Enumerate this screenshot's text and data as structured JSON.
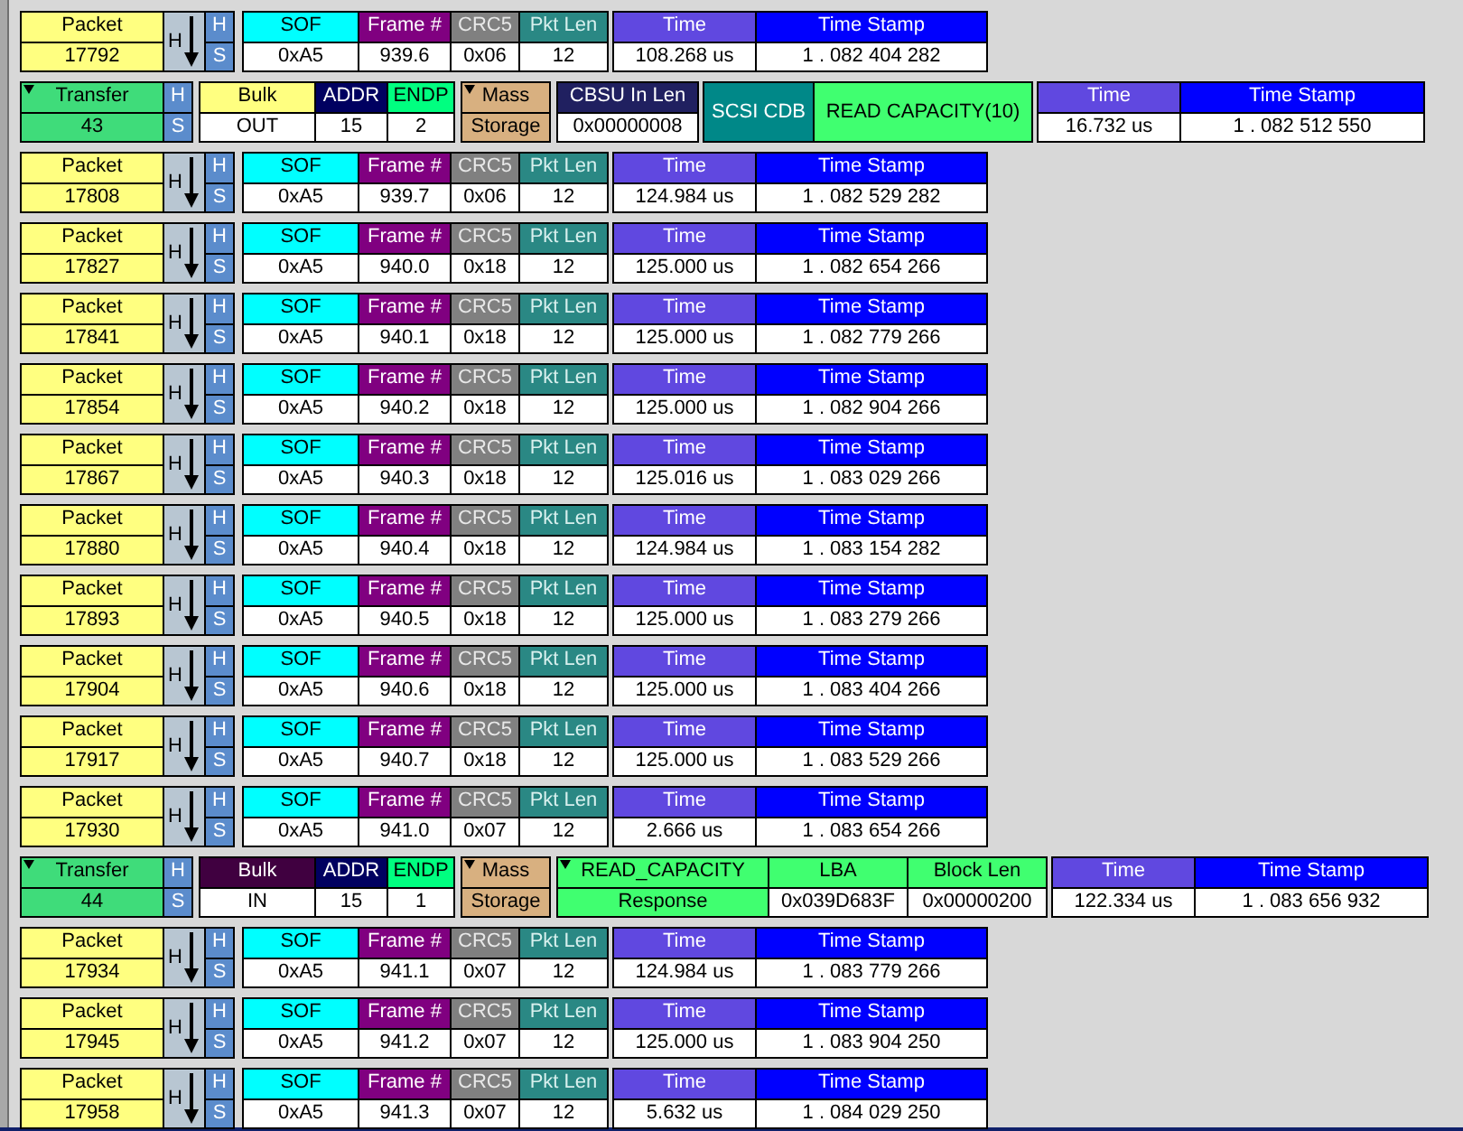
{
  "rows": [
    {
      "kind": "packet",
      "title": "Packet",
      "number": "17792",
      "arrow_label": "H",
      "speed": [
        "H",
        "S"
      ],
      "fields": [
        {
          "label": "SOF",
          "value": "0xA5"
        },
        {
          "label": "Frame #",
          "value": "939.6"
        },
        {
          "label": "CRC5",
          "value": "0x06"
        },
        {
          "label": "Pkt Len",
          "value": "12"
        }
      ],
      "time": {
        "label": "Time",
        "value": "108.268 us"
      },
      "timestamp": {
        "label": "Time Stamp",
        "value": "1 . 082 404 282"
      }
    },
    {
      "kind": "transfer",
      "title": "Transfer",
      "number": "43",
      "speed": [
        "H",
        "S"
      ],
      "incoming": false,
      "transfer": {
        "label": "Bulk",
        "value": "OUT"
      },
      "addr": {
        "label": "ADDR",
        "value": "15"
      },
      "endp": {
        "label": "ENDP",
        "value": "2"
      },
      "class": [
        "Mass",
        "Storage"
      ],
      "details": [
        {
          "kind": "field",
          "label": "CBSU In Len",
          "value": "0x00000008"
        },
        {
          "kind": "tag",
          "label": "SCSI CDB"
        },
        {
          "kind": "command",
          "label": "READ CAPACITY(10)"
        }
      ],
      "time": {
        "label": "Time",
        "value": "16.732 us"
      },
      "timestamp": {
        "label": "Time Stamp",
        "value": "1 . 082 512 550"
      }
    },
    {
      "kind": "packet",
      "title": "Packet",
      "number": "17808",
      "arrow_label": "H",
      "speed": [
        "H",
        "S"
      ],
      "fields": [
        {
          "label": "SOF",
          "value": "0xA5"
        },
        {
          "label": "Frame #",
          "value": "939.7"
        },
        {
          "label": "CRC5",
          "value": "0x06"
        },
        {
          "label": "Pkt Len",
          "value": "12"
        }
      ],
      "time": {
        "label": "Time",
        "value": "124.984 us"
      },
      "timestamp": {
        "label": "Time Stamp",
        "value": "1 . 082 529 282"
      }
    },
    {
      "kind": "packet",
      "title": "Packet",
      "number": "17827",
      "arrow_label": "H",
      "speed": [
        "H",
        "S"
      ],
      "fields": [
        {
          "label": "SOF",
          "value": "0xA5"
        },
        {
          "label": "Frame #",
          "value": "940.0"
        },
        {
          "label": "CRC5",
          "value": "0x18"
        },
        {
          "label": "Pkt Len",
          "value": "12"
        }
      ],
      "time": {
        "label": "Time",
        "value": "125.000 us"
      },
      "timestamp": {
        "label": "Time Stamp",
        "value": "1 . 082 654 266"
      }
    },
    {
      "kind": "packet",
      "title": "Packet",
      "number": "17841",
      "arrow_label": "H",
      "speed": [
        "H",
        "S"
      ],
      "fields": [
        {
          "label": "SOF",
          "value": "0xA5"
        },
        {
          "label": "Frame #",
          "value": "940.1"
        },
        {
          "label": "CRC5",
          "value": "0x18"
        },
        {
          "label": "Pkt Len",
          "value": "12"
        }
      ],
      "time": {
        "label": "Time",
        "value": "125.000 us"
      },
      "timestamp": {
        "label": "Time Stamp",
        "value": "1 . 082 779 266"
      }
    },
    {
      "kind": "packet",
      "title": "Packet",
      "number": "17854",
      "arrow_label": "H",
      "speed": [
        "H",
        "S"
      ],
      "fields": [
        {
          "label": "SOF",
          "value": "0xA5"
        },
        {
          "label": "Frame #",
          "value": "940.2"
        },
        {
          "label": "CRC5",
          "value": "0x18"
        },
        {
          "label": "Pkt Len",
          "value": "12"
        }
      ],
      "time": {
        "label": "Time",
        "value": "125.000 us"
      },
      "timestamp": {
        "label": "Time Stamp",
        "value": "1 . 082 904 266"
      }
    },
    {
      "kind": "packet",
      "title": "Packet",
      "number": "17867",
      "arrow_label": "H",
      "speed": [
        "H",
        "S"
      ],
      "fields": [
        {
          "label": "SOF",
          "value": "0xA5"
        },
        {
          "label": "Frame #",
          "value": "940.3"
        },
        {
          "label": "CRC5",
          "value": "0x18"
        },
        {
          "label": "Pkt Len",
          "value": "12"
        }
      ],
      "time": {
        "label": "Time",
        "value": "125.016 us"
      },
      "timestamp": {
        "label": "Time Stamp",
        "value": "1 . 083 029 266"
      }
    },
    {
      "kind": "packet",
      "title": "Packet",
      "number": "17880",
      "arrow_label": "H",
      "speed": [
        "H",
        "S"
      ],
      "fields": [
        {
          "label": "SOF",
          "value": "0xA5"
        },
        {
          "label": "Frame #",
          "value": "940.4"
        },
        {
          "label": "CRC5",
          "value": "0x18"
        },
        {
          "label": "Pkt Len",
          "value": "12"
        }
      ],
      "time": {
        "label": "Time",
        "value": "124.984 us"
      },
      "timestamp": {
        "label": "Time Stamp",
        "value": "1 . 083 154 282"
      }
    },
    {
      "kind": "packet",
      "title": "Packet",
      "number": "17893",
      "arrow_label": "H",
      "speed": [
        "H",
        "S"
      ],
      "fields": [
        {
          "label": "SOF",
          "value": "0xA5"
        },
        {
          "label": "Frame #",
          "value": "940.5"
        },
        {
          "label": "CRC5",
          "value": "0x18"
        },
        {
          "label": "Pkt Len",
          "value": "12"
        }
      ],
      "time": {
        "label": "Time",
        "value": "125.000 us"
      },
      "timestamp": {
        "label": "Time Stamp",
        "value": "1 . 083 279 266"
      }
    },
    {
      "kind": "packet",
      "title": "Packet",
      "number": "17904",
      "arrow_label": "H",
      "speed": [
        "H",
        "S"
      ],
      "fields": [
        {
          "label": "SOF",
          "value": "0xA5"
        },
        {
          "label": "Frame #",
          "value": "940.6"
        },
        {
          "label": "CRC5",
          "value": "0x18"
        },
        {
          "label": "Pkt Len",
          "value": "12"
        }
      ],
      "time": {
        "label": "Time",
        "value": "125.000 us"
      },
      "timestamp": {
        "label": "Time Stamp",
        "value": "1 . 083 404 266"
      }
    },
    {
      "kind": "packet",
      "title": "Packet",
      "number": "17917",
      "arrow_label": "H",
      "speed": [
        "H",
        "S"
      ],
      "fields": [
        {
          "label": "SOF",
          "value": "0xA5"
        },
        {
          "label": "Frame #",
          "value": "940.7"
        },
        {
          "label": "CRC5",
          "value": "0x18"
        },
        {
          "label": "Pkt Len",
          "value": "12"
        }
      ],
      "time": {
        "label": "Time",
        "value": "125.000 us"
      },
      "timestamp": {
        "label": "Time Stamp",
        "value": "1 . 083 529 266"
      }
    },
    {
      "kind": "packet",
      "title": "Packet",
      "number": "17930",
      "arrow_label": "H",
      "speed": [
        "H",
        "S"
      ],
      "fields": [
        {
          "label": "SOF",
          "value": "0xA5"
        },
        {
          "label": "Frame #",
          "value": "941.0"
        },
        {
          "label": "CRC5",
          "value": "0x07"
        },
        {
          "label": "Pkt Len",
          "value": "12"
        }
      ],
      "time": {
        "label": "Time",
        "value": "2.666 us"
      },
      "timestamp": {
        "label": "Time Stamp",
        "value": "1 . 083 654 266"
      }
    },
    {
      "kind": "transfer",
      "title": "Transfer",
      "number": "44",
      "speed": [
        "H",
        "S"
      ],
      "incoming": true,
      "transfer": {
        "label": "Bulk",
        "value": "IN"
      },
      "addr": {
        "label": "ADDR",
        "value": "15"
      },
      "endp": {
        "label": "ENDP",
        "value": "1"
      },
      "class": [
        "Mass",
        "Storage"
      ],
      "details": [
        {
          "kind": "response",
          "label": "READ_CAPACITY",
          "value": "Response"
        },
        {
          "kind": "decode",
          "label": "LBA",
          "value": "0x039D683F"
        },
        {
          "kind": "decode",
          "label": "Block Len",
          "value": "0x00000200"
        }
      ],
      "time": {
        "label": "Time",
        "value": "122.334 us"
      },
      "timestamp": {
        "label": "Time Stamp",
        "value": "1 . 083 656 932"
      }
    },
    {
      "kind": "packet",
      "title": "Packet",
      "number": "17934",
      "arrow_label": "H",
      "speed": [
        "H",
        "S"
      ],
      "fields": [
        {
          "label": "SOF",
          "value": "0xA5"
        },
        {
          "label": "Frame #",
          "value": "941.1"
        },
        {
          "label": "CRC5",
          "value": "0x07"
        },
        {
          "label": "Pkt Len",
          "value": "12"
        }
      ],
      "time": {
        "label": "Time",
        "value": "124.984 us"
      },
      "timestamp": {
        "label": "Time Stamp",
        "value": "1 . 083 779 266"
      }
    },
    {
      "kind": "packet",
      "title": "Packet",
      "number": "17945",
      "arrow_label": "H",
      "speed": [
        "H",
        "S"
      ],
      "fields": [
        {
          "label": "SOF",
          "value": "0xA5"
        },
        {
          "label": "Frame #",
          "value": "941.2"
        },
        {
          "label": "CRC5",
          "value": "0x07"
        },
        {
          "label": "Pkt Len",
          "value": "12"
        }
      ],
      "time": {
        "label": "Time",
        "value": "125.000 us"
      },
      "timestamp": {
        "label": "Time Stamp",
        "value": "1 . 083 904 250"
      }
    },
    {
      "kind": "packet",
      "title": "Packet",
      "number": "17958",
      "arrow_label": "H",
      "speed": [
        "H",
        "S"
      ],
      "fields": [
        {
          "label": "SOF",
          "value": "0xA5"
        },
        {
          "label": "Frame #",
          "value": "941.3"
        },
        {
          "label": "CRC5",
          "value": "0x07"
        },
        {
          "label": "Pkt Len",
          "value": "12"
        }
      ],
      "time": {
        "label": "Time",
        "value": "5.632 us"
      },
      "timestamp": {
        "label": "Time Stamp",
        "value": "1 . 084 029 250"
      }
    }
  ]
}
